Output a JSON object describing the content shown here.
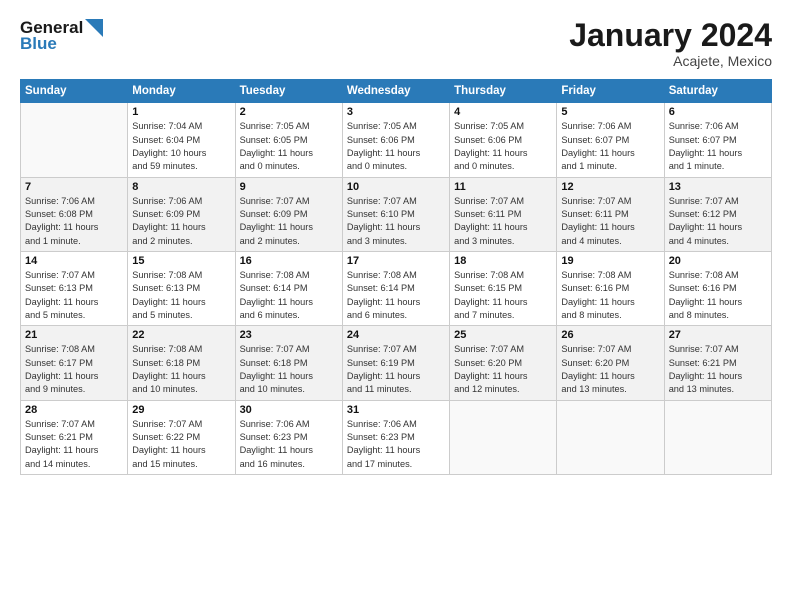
{
  "logo": {
    "line1": "General",
    "line2": "Blue"
  },
  "title": "January 2024",
  "location": "Acajete, Mexico",
  "days_header": [
    "Sunday",
    "Monday",
    "Tuesday",
    "Wednesday",
    "Thursday",
    "Friday",
    "Saturday"
  ],
  "weeks": [
    [
      {
        "day": "",
        "info": ""
      },
      {
        "day": "1",
        "info": "Sunrise: 7:04 AM\nSunset: 6:04 PM\nDaylight: 10 hours\nand 59 minutes."
      },
      {
        "day": "2",
        "info": "Sunrise: 7:05 AM\nSunset: 6:05 PM\nDaylight: 11 hours\nand 0 minutes."
      },
      {
        "day": "3",
        "info": "Sunrise: 7:05 AM\nSunset: 6:06 PM\nDaylight: 11 hours\nand 0 minutes."
      },
      {
        "day": "4",
        "info": "Sunrise: 7:05 AM\nSunset: 6:06 PM\nDaylight: 11 hours\nand 0 minutes."
      },
      {
        "day": "5",
        "info": "Sunrise: 7:06 AM\nSunset: 6:07 PM\nDaylight: 11 hours\nand 1 minute."
      },
      {
        "day": "6",
        "info": "Sunrise: 7:06 AM\nSunset: 6:07 PM\nDaylight: 11 hours\nand 1 minute."
      }
    ],
    [
      {
        "day": "7",
        "info": "Sunrise: 7:06 AM\nSunset: 6:08 PM\nDaylight: 11 hours\nand 1 minute."
      },
      {
        "day": "8",
        "info": "Sunrise: 7:06 AM\nSunset: 6:09 PM\nDaylight: 11 hours\nand 2 minutes."
      },
      {
        "day": "9",
        "info": "Sunrise: 7:07 AM\nSunset: 6:09 PM\nDaylight: 11 hours\nand 2 minutes."
      },
      {
        "day": "10",
        "info": "Sunrise: 7:07 AM\nSunset: 6:10 PM\nDaylight: 11 hours\nand 3 minutes."
      },
      {
        "day": "11",
        "info": "Sunrise: 7:07 AM\nSunset: 6:11 PM\nDaylight: 11 hours\nand 3 minutes."
      },
      {
        "day": "12",
        "info": "Sunrise: 7:07 AM\nSunset: 6:11 PM\nDaylight: 11 hours\nand 4 minutes."
      },
      {
        "day": "13",
        "info": "Sunrise: 7:07 AM\nSunset: 6:12 PM\nDaylight: 11 hours\nand 4 minutes."
      }
    ],
    [
      {
        "day": "14",
        "info": "Sunrise: 7:07 AM\nSunset: 6:13 PM\nDaylight: 11 hours\nand 5 minutes."
      },
      {
        "day": "15",
        "info": "Sunrise: 7:08 AM\nSunset: 6:13 PM\nDaylight: 11 hours\nand 5 minutes."
      },
      {
        "day": "16",
        "info": "Sunrise: 7:08 AM\nSunset: 6:14 PM\nDaylight: 11 hours\nand 6 minutes."
      },
      {
        "day": "17",
        "info": "Sunrise: 7:08 AM\nSunset: 6:14 PM\nDaylight: 11 hours\nand 6 minutes."
      },
      {
        "day": "18",
        "info": "Sunrise: 7:08 AM\nSunset: 6:15 PM\nDaylight: 11 hours\nand 7 minutes."
      },
      {
        "day": "19",
        "info": "Sunrise: 7:08 AM\nSunset: 6:16 PM\nDaylight: 11 hours\nand 8 minutes."
      },
      {
        "day": "20",
        "info": "Sunrise: 7:08 AM\nSunset: 6:16 PM\nDaylight: 11 hours\nand 8 minutes."
      }
    ],
    [
      {
        "day": "21",
        "info": "Sunrise: 7:08 AM\nSunset: 6:17 PM\nDaylight: 11 hours\nand 9 minutes."
      },
      {
        "day": "22",
        "info": "Sunrise: 7:08 AM\nSunset: 6:18 PM\nDaylight: 11 hours\nand 10 minutes."
      },
      {
        "day": "23",
        "info": "Sunrise: 7:07 AM\nSunset: 6:18 PM\nDaylight: 11 hours\nand 10 minutes."
      },
      {
        "day": "24",
        "info": "Sunrise: 7:07 AM\nSunset: 6:19 PM\nDaylight: 11 hours\nand 11 minutes."
      },
      {
        "day": "25",
        "info": "Sunrise: 7:07 AM\nSunset: 6:20 PM\nDaylight: 11 hours\nand 12 minutes."
      },
      {
        "day": "26",
        "info": "Sunrise: 7:07 AM\nSunset: 6:20 PM\nDaylight: 11 hours\nand 13 minutes."
      },
      {
        "day": "27",
        "info": "Sunrise: 7:07 AM\nSunset: 6:21 PM\nDaylight: 11 hours\nand 13 minutes."
      }
    ],
    [
      {
        "day": "28",
        "info": "Sunrise: 7:07 AM\nSunset: 6:21 PM\nDaylight: 11 hours\nand 14 minutes."
      },
      {
        "day": "29",
        "info": "Sunrise: 7:07 AM\nSunset: 6:22 PM\nDaylight: 11 hours\nand 15 minutes."
      },
      {
        "day": "30",
        "info": "Sunrise: 7:06 AM\nSunset: 6:23 PM\nDaylight: 11 hours\nand 16 minutes."
      },
      {
        "day": "31",
        "info": "Sunrise: 7:06 AM\nSunset: 6:23 PM\nDaylight: 11 hours\nand 17 minutes."
      },
      {
        "day": "",
        "info": ""
      },
      {
        "day": "",
        "info": ""
      },
      {
        "day": "",
        "info": ""
      }
    ]
  ]
}
